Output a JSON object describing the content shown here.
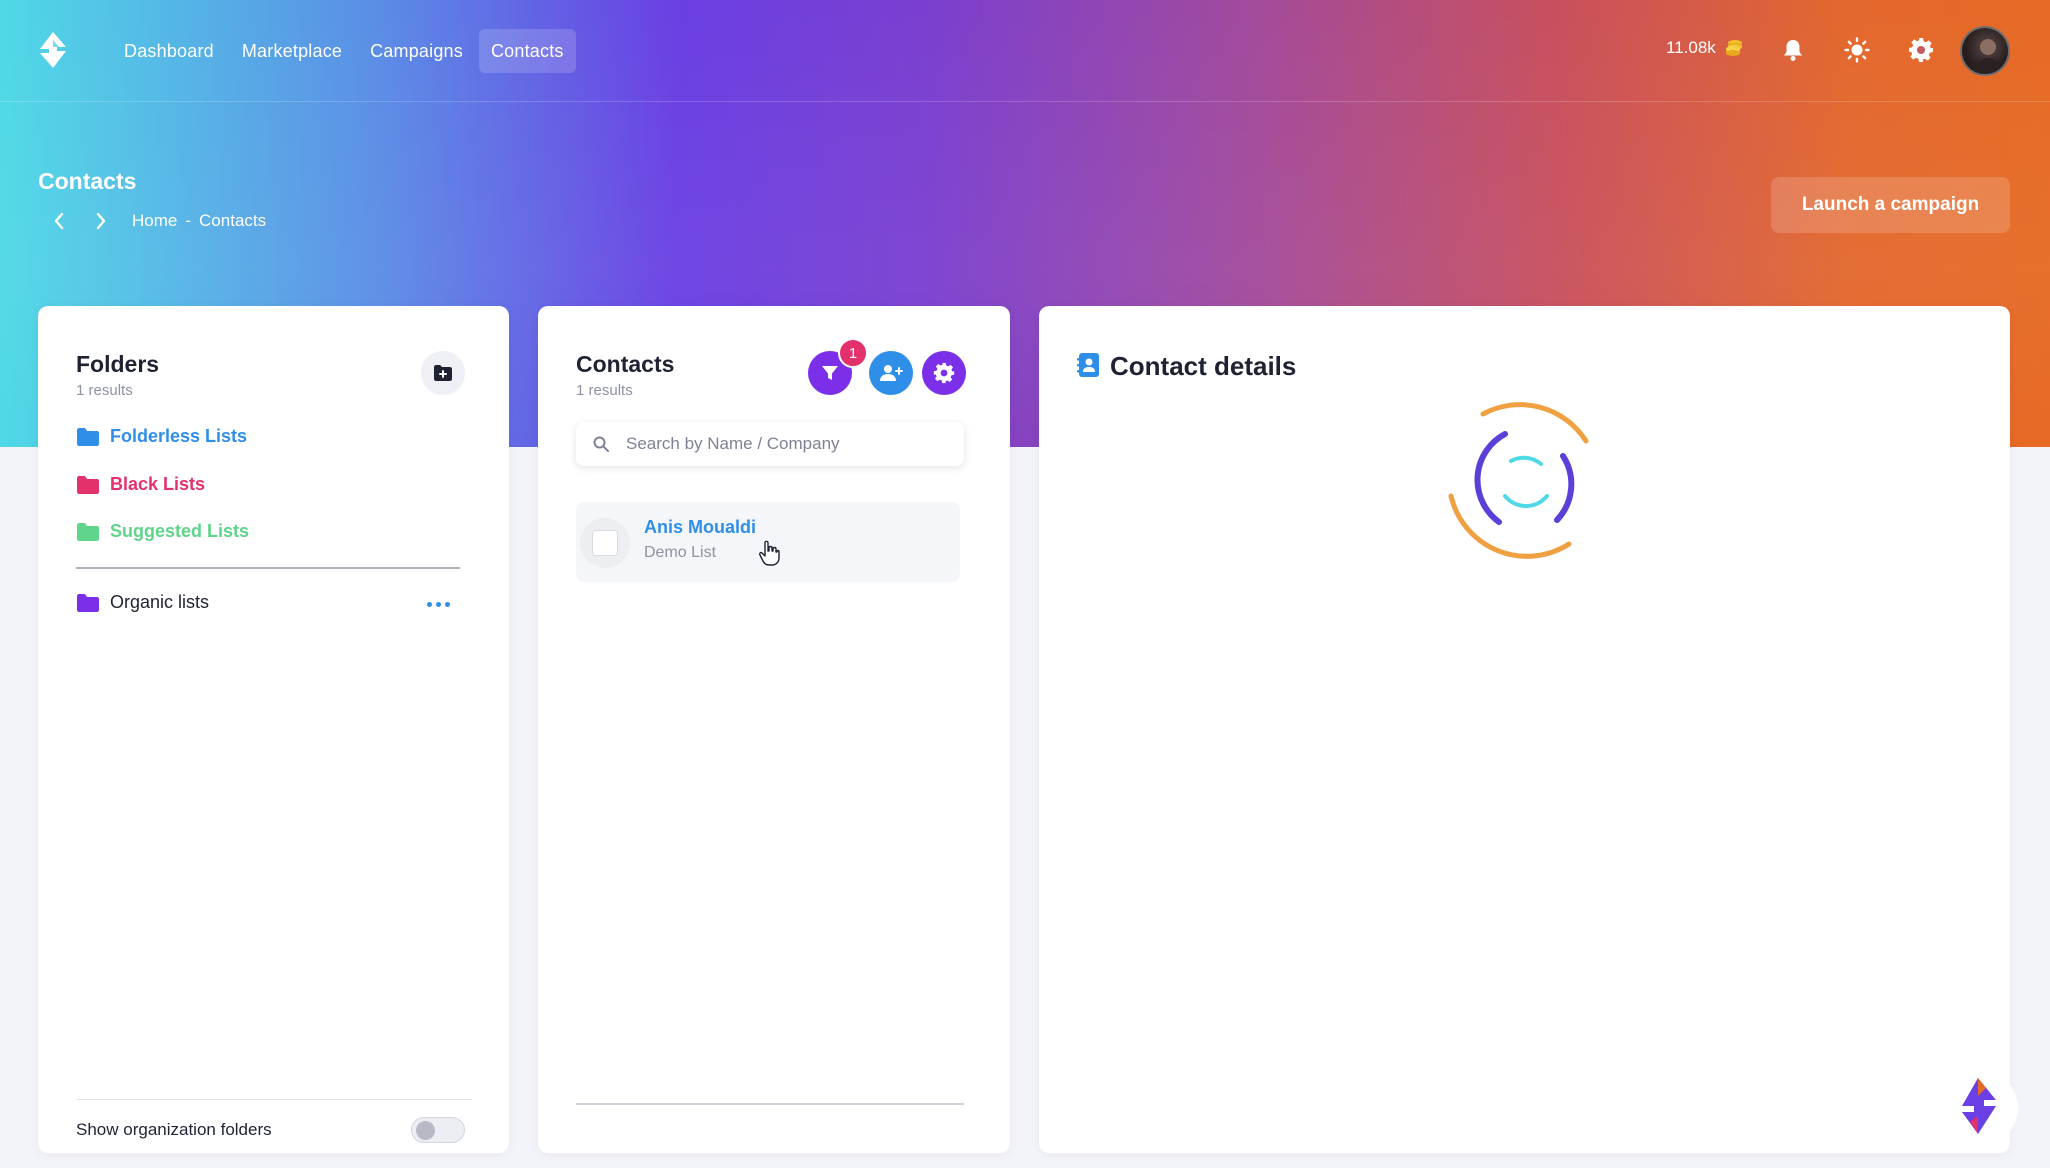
{
  "nav": {
    "items": [
      {
        "label": "Dashboard"
      },
      {
        "label": "Marketplace"
      },
      {
        "label": "Campaigns"
      },
      {
        "label": "Contacts"
      }
    ],
    "active": "Contacts"
  },
  "header": {
    "credits": "11.08k",
    "icons": [
      "bell-icon",
      "sun-icon",
      "gear-icon"
    ],
    "page_title": "Contacts",
    "breadcrumb": {
      "home": "Home",
      "separator": "-",
      "current": "Contacts"
    },
    "launch_button": "Launch a campaign"
  },
  "folders": {
    "title": "Folders",
    "count": "1 results",
    "items": [
      {
        "label": "Folderless Lists",
        "color": "#2f8ee8"
      },
      {
        "label": "Black Lists",
        "color": "#e3326b"
      },
      {
        "label": "Suggested Lists",
        "color": "#5fd48a"
      }
    ],
    "organic": {
      "label": "Organic lists",
      "color": "#7c2fe8"
    },
    "toggle_label": "Show organization folders"
  },
  "contacts": {
    "title": "Contacts",
    "count": "1 results",
    "filter_badge": "1",
    "search_placeholder": "Search by Name / Company",
    "rows": [
      {
        "name": "Anis Moualdi",
        "list": "Demo List"
      }
    ]
  },
  "details": {
    "title": "Contact details"
  },
  "colors": {
    "purple": "#7c2fe8",
    "blue": "#2f8ee8",
    "pink": "#e3326b",
    "green": "#5fd48a",
    "orange": "#f0a040"
  }
}
